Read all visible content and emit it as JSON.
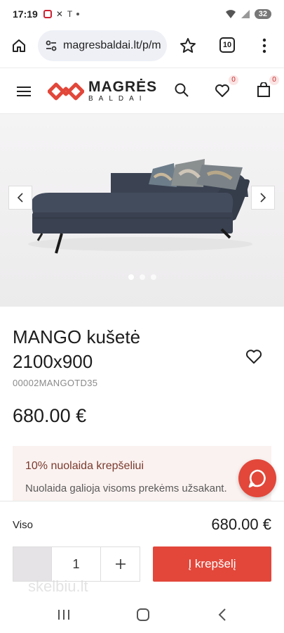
{
  "status_bar": {
    "time": "17:19",
    "battery": "32"
  },
  "browser": {
    "url": "magresbaldai.lt/p/m",
    "tab_count": "10"
  },
  "header": {
    "logo_main": "MAGRĖS",
    "logo_sub": "BALDAI",
    "wishlist_count": "0",
    "cart_count": "0"
  },
  "gallery": {
    "slide_count": 3,
    "active_index": 0
  },
  "product": {
    "title": "MANGO kušetė 2100x900",
    "code": "00002MANGOTD35",
    "price": "680.00 €"
  },
  "promo": {
    "title": "10% nuolaida krepšeliui",
    "text": "Nuolaida galioja visoms prekėms užsakant."
  },
  "cart_bar": {
    "total_label": "Viso",
    "total_value": "680.00 €",
    "quantity": "1",
    "add_to_cart_label": "Į krepšelį",
    "watermark": "skelbiu.lt"
  },
  "colors": {
    "accent": "#e2473a",
    "promo_bg": "#faf2f0"
  }
}
